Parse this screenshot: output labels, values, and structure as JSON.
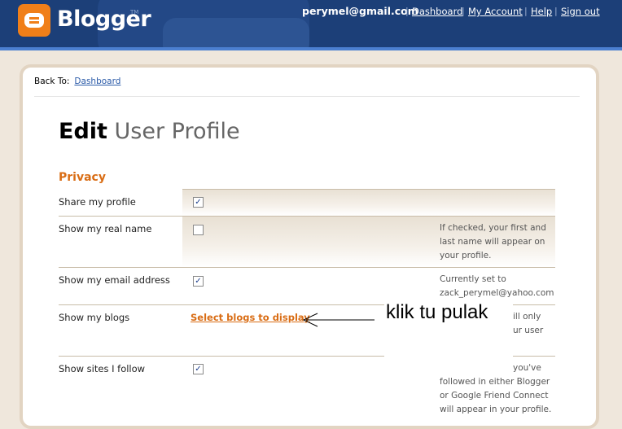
{
  "header": {
    "logo_text": "Blogger",
    "trademark": "TM",
    "user_email": "perymel@gmail.com",
    "links": [
      "Dashboard",
      "My Account",
      "Help",
      "Sign out"
    ]
  },
  "back": {
    "label": "Back To:",
    "link": "Dashboard"
  },
  "page": {
    "title_bold": "Edit",
    "title_rest": " User Profile",
    "section": "Privacy"
  },
  "rows": [
    {
      "label": "Share my profile",
      "checked": true
    },
    {
      "label": "Show my real name",
      "checked": false,
      "help": "If checked, your first and last name will appear on your profile."
    },
    {
      "label": "Show my email address",
      "checked": true,
      "help": "Currently set to zack_perymel@yahoo.com"
    },
    {
      "label": "Show my blogs",
      "link": "Select blogs to display",
      "help_fragment_1": "ill only",
      "help_fragment_2": "ur user"
    },
    {
      "label": "Show sites I follow",
      "checked": true,
      "help": "followed in either Blogger or Google Friend Connect will appear in your profile.",
      "help_fragment_top": "you've"
    }
  ],
  "annotation": "klik tu pulak",
  "colors": {
    "header": "#1c3f78",
    "accent": "#d96d15",
    "logo": "#f07f19"
  }
}
